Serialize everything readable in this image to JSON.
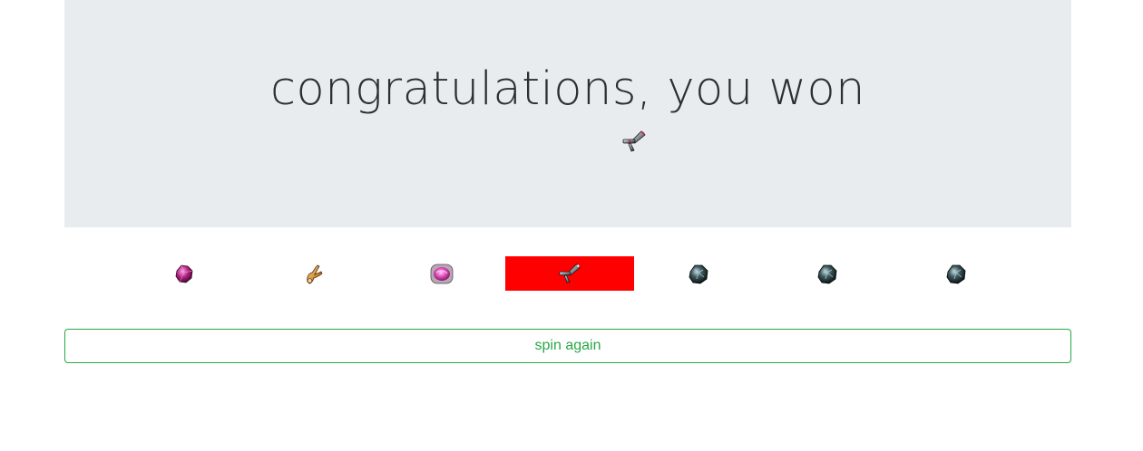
{
  "banner": {
    "title": "congratulations, you won",
    "won_item_icon": "currency-injector-icon"
  },
  "reel": {
    "selected_index": 3,
    "highlight_color": "#ff0000",
    "items": [
      {
        "icon": "magenta-crystal-icon"
      },
      {
        "icon": "golden-claw-icon"
      },
      {
        "icon": "pink-orb-icon"
      },
      {
        "icon": "currency-injector-icon"
      },
      {
        "icon": "dark-fossil-icon"
      },
      {
        "icon": "dark-fossil-icon"
      },
      {
        "icon": "dark-fossil-icon"
      }
    ]
  },
  "actions": {
    "spin_again_label": "spin again",
    "accent_color": "#28a745"
  }
}
